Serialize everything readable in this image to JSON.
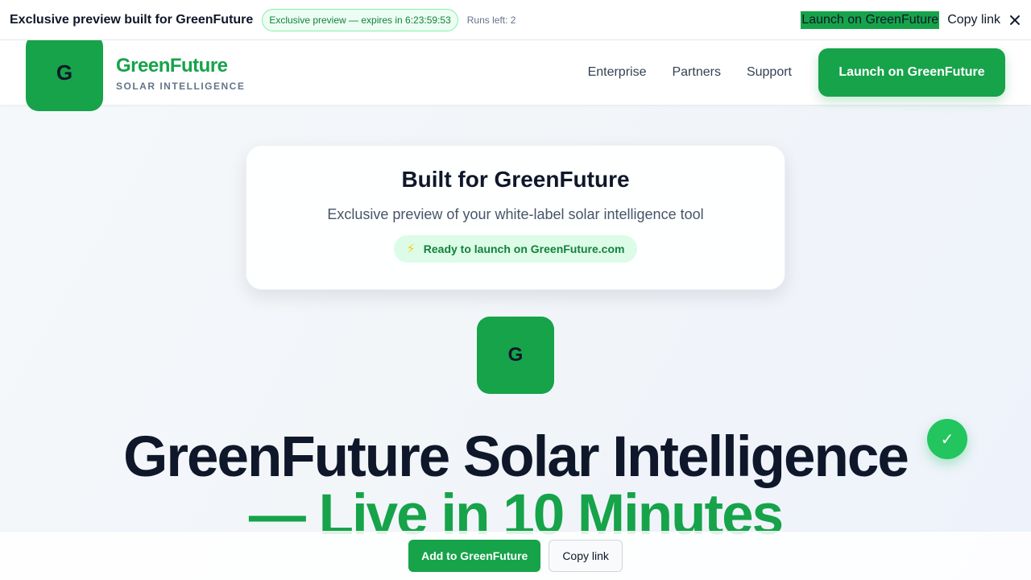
{
  "topbar": {
    "title": "Exclusive preview built for GreenFuture",
    "expire_badge": "Exclusive preview — expires in 6:23:59:53",
    "runs_left": "Runs left: 2",
    "launch_label": "Launch on GreenFuture",
    "copy_label": "Copy link",
    "close_icon": "close-icon"
  },
  "header": {
    "logo_letter": "G",
    "brand_name": "GreenFuture",
    "brand_sub": "SOLAR INTELLIGENCE",
    "nav": [
      "Enterprise",
      "Partners",
      "Support"
    ],
    "cta_label": "Launch on GreenFuture"
  },
  "card": {
    "title": "Built for GreenFuture",
    "description": "Exclusive preview of your white-label solar intelligence tool",
    "ready_icon": "lightning-bolt-icon",
    "ready_label": "Ready to launch on GreenFuture.com"
  },
  "hero": {
    "logo_letter": "G",
    "check_icon": "✓",
    "title_line1": "GreenFuture Solar Intelligence",
    "title_line2": "— Live in 10 Minutes"
  },
  "bottombar": {
    "add_label": "Add to GreenFuture",
    "copy_label": "Copy link"
  },
  "colors": {
    "brand_green": "#16a34a",
    "check_green": "#22c55e",
    "text_dark": "#0f172a"
  }
}
